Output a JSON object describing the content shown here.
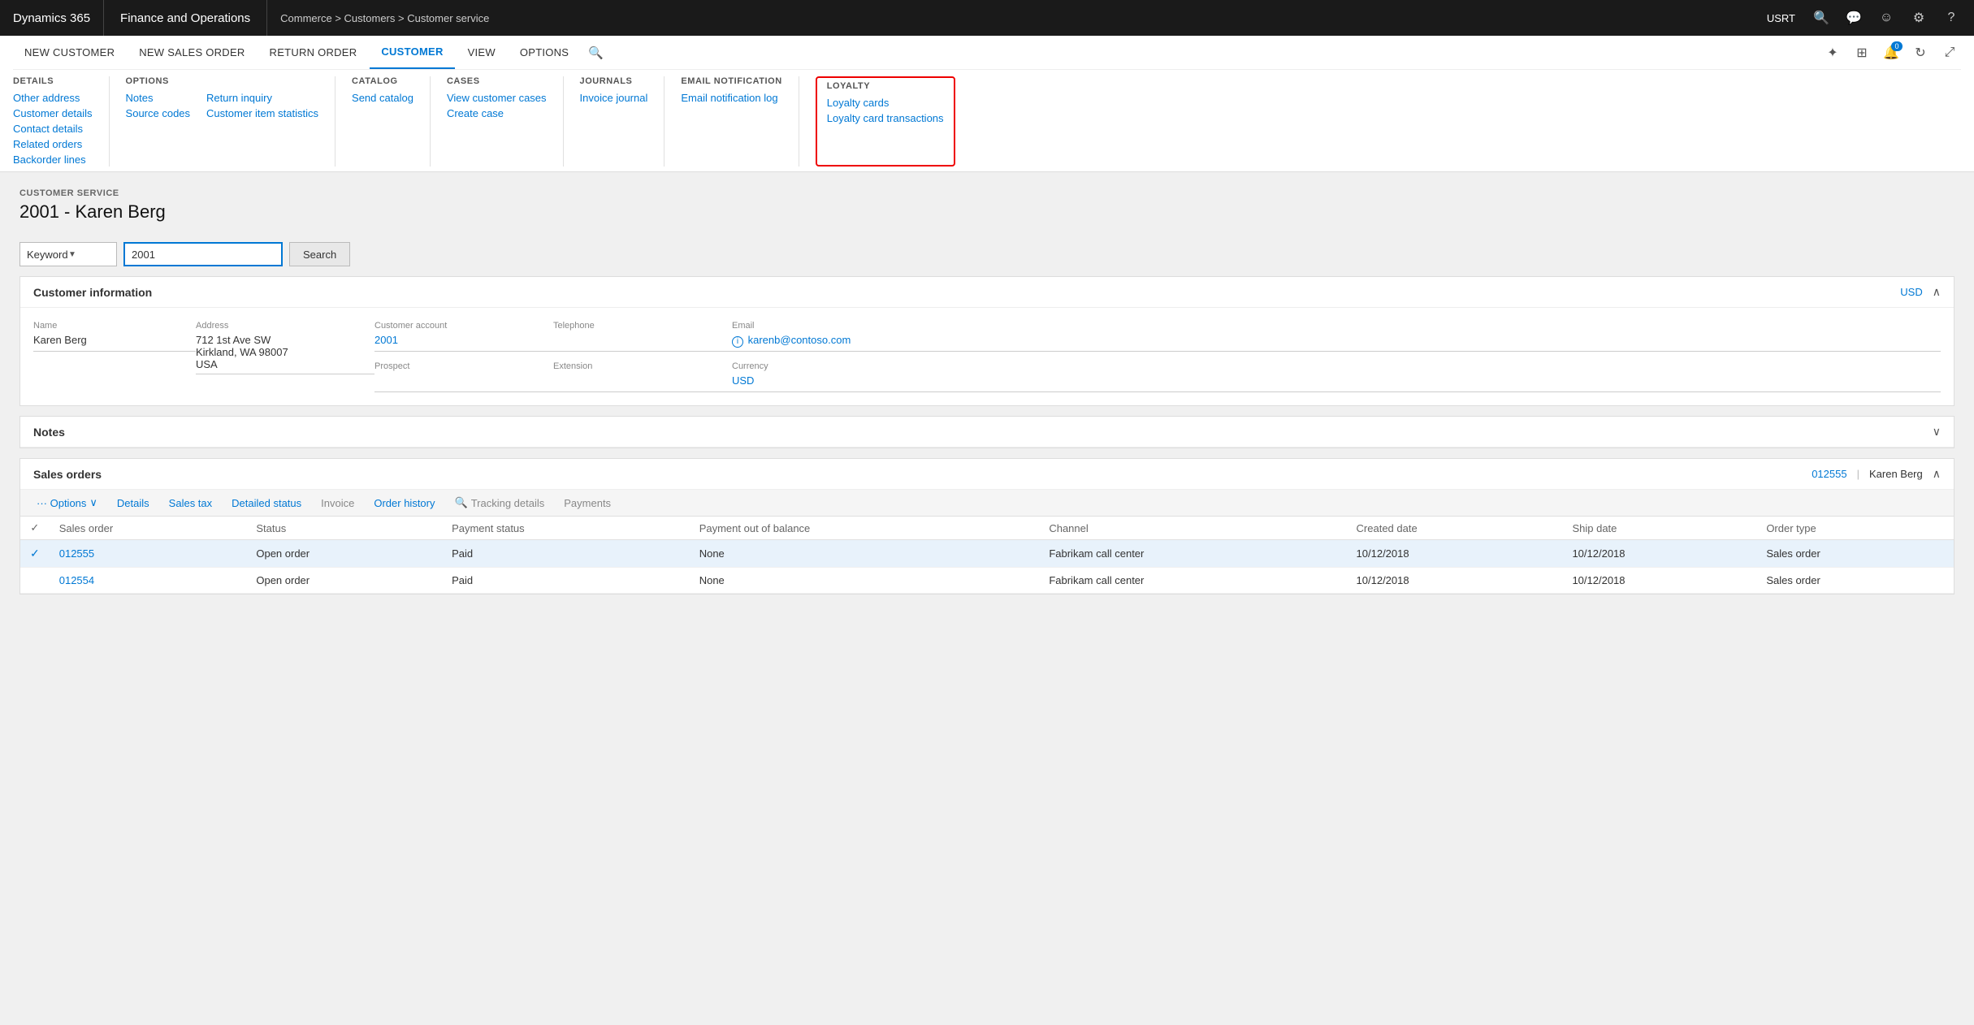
{
  "topbar": {
    "dynamics_label": "Dynamics 365",
    "app_label": "Finance and Operations",
    "breadcrumb": "Commerce > Customers > Customer service",
    "user": "USRT",
    "icons": {
      "search": "🔍",
      "chat": "💬",
      "face": "☺",
      "gear": "⚙",
      "question": "?"
    },
    "notification_count": "0"
  },
  "ribbon": {
    "tabs": [
      {
        "id": "new-customer",
        "label": "New customer",
        "active": false
      },
      {
        "id": "new-sales-order",
        "label": "New sales order",
        "active": false
      },
      {
        "id": "return-order",
        "label": "Return order",
        "active": false
      },
      {
        "id": "customer",
        "label": "CUSTOMER",
        "active": true
      },
      {
        "id": "view",
        "label": "VIEW",
        "active": false
      },
      {
        "id": "options",
        "label": "OPTIONS",
        "active": false
      }
    ],
    "groups": {
      "details": {
        "title": "DETAILS",
        "items": [
          [
            "Other address",
            "Customer details"
          ],
          [
            "Contact details",
            "Related orders"
          ],
          [
            "Backorder lines",
            ""
          ]
        ]
      },
      "options": {
        "title": "OPTIONS",
        "cols": [
          [
            "Notes",
            "Source codes"
          ],
          [
            "Return inquiry",
            "Customer item statistics"
          ]
        ]
      },
      "catalog": {
        "title": "CATALOG",
        "items": [
          "Send catalog"
        ]
      },
      "cases": {
        "title": "CASES",
        "items": [
          "View customer cases",
          "Create case"
        ]
      },
      "journals": {
        "title": "JOURNALS",
        "items": [
          "Invoice journal"
        ]
      },
      "email_notification": {
        "title": "EMAIL NOTIFICATION",
        "items": [
          "Email notification log"
        ]
      },
      "loyalty": {
        "title": "LOYALTY",
        "items": [
          "Loyalty cards",
          "Loyalty card transactions"
        ]
      }
    }
  },
  "customer_service": {
    "section_label": "CUSTOMER SERVICE",
    "title": "2001 - Karen Berg"
  },
  "search": {
    "keyword_label": "Keyword",
    "input_value": "2001",
    "button_label": "Search"
  },
  "customer_info": {
    "section_title": "Customer information",
    "currency_link": "USD",
    "fields": {
      "name_label": "Name",
      "name_value": "Karen Berg",
      "address_label": "Address",
      "address_line1": "712 1st Ave SW",
      "address_line2": "Kirkland, WA 98007",
      "address_line3": "USA",
      "account_label": "Customer account",
      "account_value": "2001",
      "prospect_label": "Prospect",
      "prospect_value": "",
      "telephone_label": "Telephone",
      "telephone_value": "",
      "extension_label": "Extension",
      "extension_value": "",
      "email_label": "Email",
      "email_value": "karenb@contoso.com",
      "currency_label": "Currency",
      "currency_value": "USD"
    }
  },
  "notes": {
    "section_title": "Notes"
  },
  "sales_orders": {
    "section_title": "Sales orders",
    "header_link": "012555",
    "header_customer": "Karen Berg",
    "toolbar": {
      "options_label": "··· Options",
      "options_chevron": "∨",
      "details_label": "Details",
      "sales_tax_label": "Sales tax",
      "detailed_status_label": "Detailed status",
      "invoice_label": "Invoice",
      "order_history_label": "Order history",
      "tracking_icon": "🔍",
      "tracking_label": "Tracking details",
      "payments_label": "Payments"
    },
    "columns": [
      "Sales order",
      "Status",
      "Payment status",
      "Payment out of balance",
      "Channel",
      "Created date",
      "Ship date",
      "Order type"
    ],
    "rows": [
      {
        "selected": true,
        "sales_order": "012555",
        "status": "Open order",
        "payment_status": "Paid",
        "payment_out_of_balance": "None",
        "channel": "Fabrikam call center",
        "created_date": "10/12/2018",
        "ship_date": "10/12/2018",
        "order_type": "Sales order"
      },
      {
        "selected": false,
        "sales_order": "012554",
        "status": "Open order",
        "payment_status": "Paid",
        "payment_out_of_balance": "None",
        "channel": "Fabrikam call center",
        "created_date": "10/12/2018",
        "ship_date": "10/12/2018",
        "order_type": "Sales order"
      }
    ]
  }
}
